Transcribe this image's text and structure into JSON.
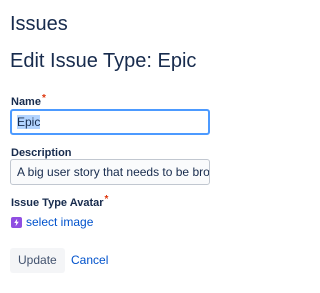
{
  "page": {
    "heading": "Issues"
  },
  "form": {
    "title": "Edit Issue Type: Epic",
    "name_field": {
      "label": "Name",
      "required_marker": "*",
      "value": "Epic"
    },
    "description_field": {
      "label": "Description",
      "value": "A big user story that needs to be broken down."
    },
    "avatar_field": {
      "label": "Issue Type Avatar",
      "required_marker": "*",
      "link_label": "select image",
      "icon": "epic-lightning-icon",
      "icon_color": "#904ee2"
    },
    "actions": {
      "update_label": "Update",
      "cancel_label": "Cancel"
    }
  },
  "colors": {
    "text": "#172b4d",
    "link": "#0052cc",
    "focus_border": "#4c9aff",
    "required": "#de350b",
    "selection": "#b3d4ff"
  }
}
